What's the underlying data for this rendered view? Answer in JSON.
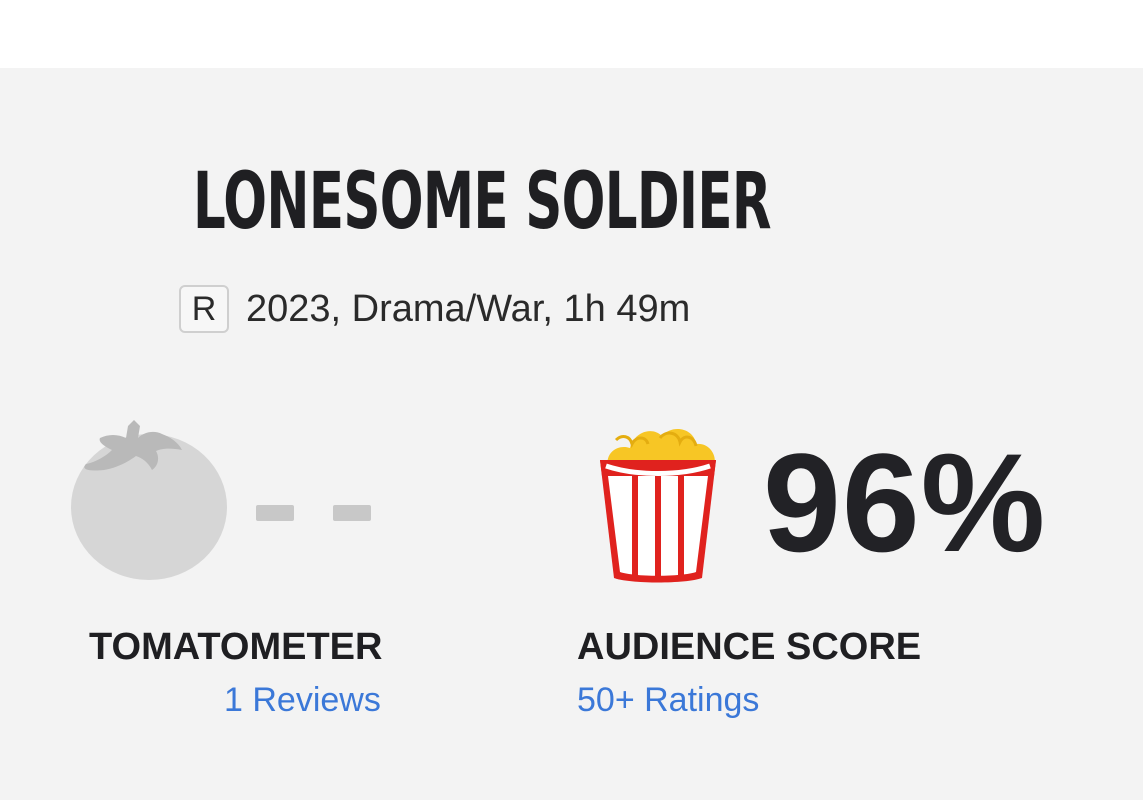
{
  "movie": {
    "title": "LONESOME SOLDIER",
    "rating": "R",
    "info": "2023, Drama/War, 1h 49m"
  },
  "tomatometer": {
    "icon": "tomato-empty-icon",
    "value": "- -",
    "label": "TOMATOMETER",
    "reviews_link": "1 Reviews"
  },
  "audience": {
    "icon": "popcorn-full-icon",
    "value": "96%",
    "label": "AUDIENCE SCORE",
    "ratings_link": "50+ Ratings"
  },
  "colors": {
    "background": "#f3f3f3",
    "text": "#1f1f22",
    "link": "#3b78d8",
    "empty_icon": "#d6d6d6",
    "popcorn_red": "#e0221e",
    "popcorn_yellow": "#f7c625"
  }
}
